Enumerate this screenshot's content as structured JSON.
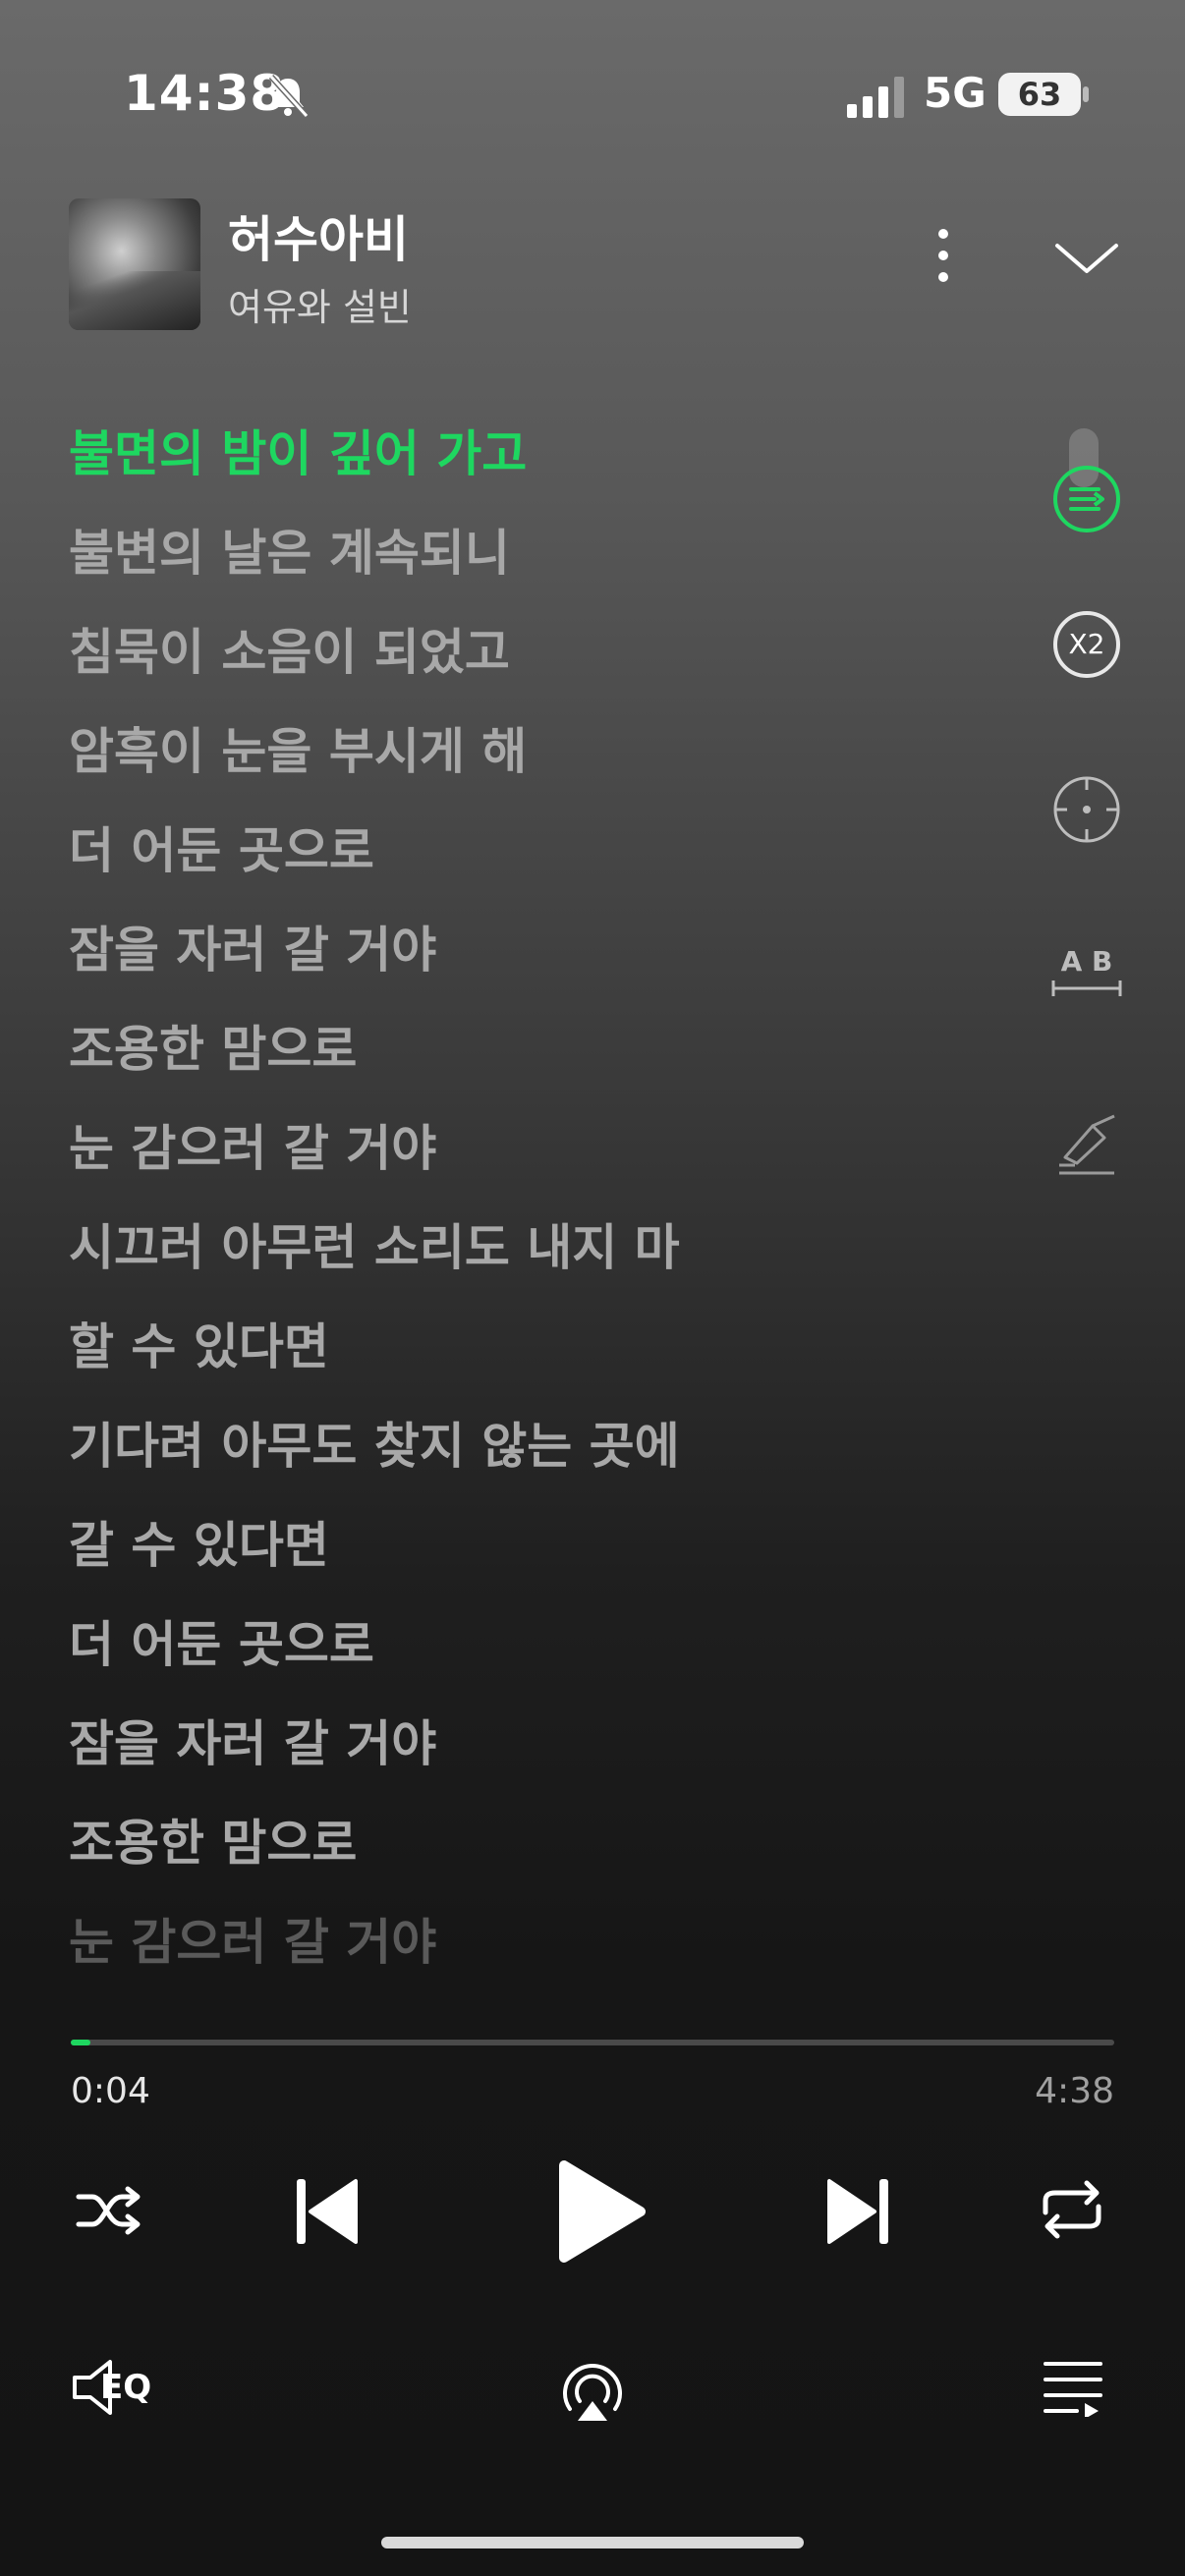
{
  "status": {
    "time": "14:38",
    "network": "5G",
    "battery": "63"
  },
  "track": {
    "title": "허수아비",
    "artist": "여유와 설빈"
  },
  "lyrics": [
    "불면의 밤이 깊어 가고",
    "불변의 날은 계속되니",
    "침묵이 소음이 되었고",
    "암흑이 눈을 부시게 해",
    "더 어둔 곳으로",
    "잠을 자러 갈 거야",
    "조용한 맘으로",
    "눈 감으러 갈 거야",
    "시끄러 아무런 소리도 내지 마",
    "할 수 있다면",
    "기다려 아무도 찾지 않는 곳에",
    "갈 수 있다면",
    "더 어둔 곳으로",
    "잠을 자러 갈 거야",
    "조용한 맘으로",
    "눈 감으러 갈 거야"
  ],
  "tools": {
    "speed": "X2",
    "ab": "A B"
  },
  "playback": {
    "current": "0:04",
    "total": "4:38",
    "progress": 0.015
  },
  "bottom": {
    "eq": "EQ"
  },
  "colors": {
    "accent": "#1ed760"
  },
  "icons": [
    "bell-off-icon",
    "signal-icon",
    "more-icon",
    "chevron-down-icon",
    "lyrics-sync-icon",
    "speed-icon",
    "crosshair-icon",
    "ab-repeat-icon",
    "highlight-icon",
    "shuffle-icon",
    "previous-icon",
    "play-icon",
    "next-icon",
    "repeat-icon",
    "eq-icon",
    "airplay-icon",
    "queue-icon"
  ]
}
